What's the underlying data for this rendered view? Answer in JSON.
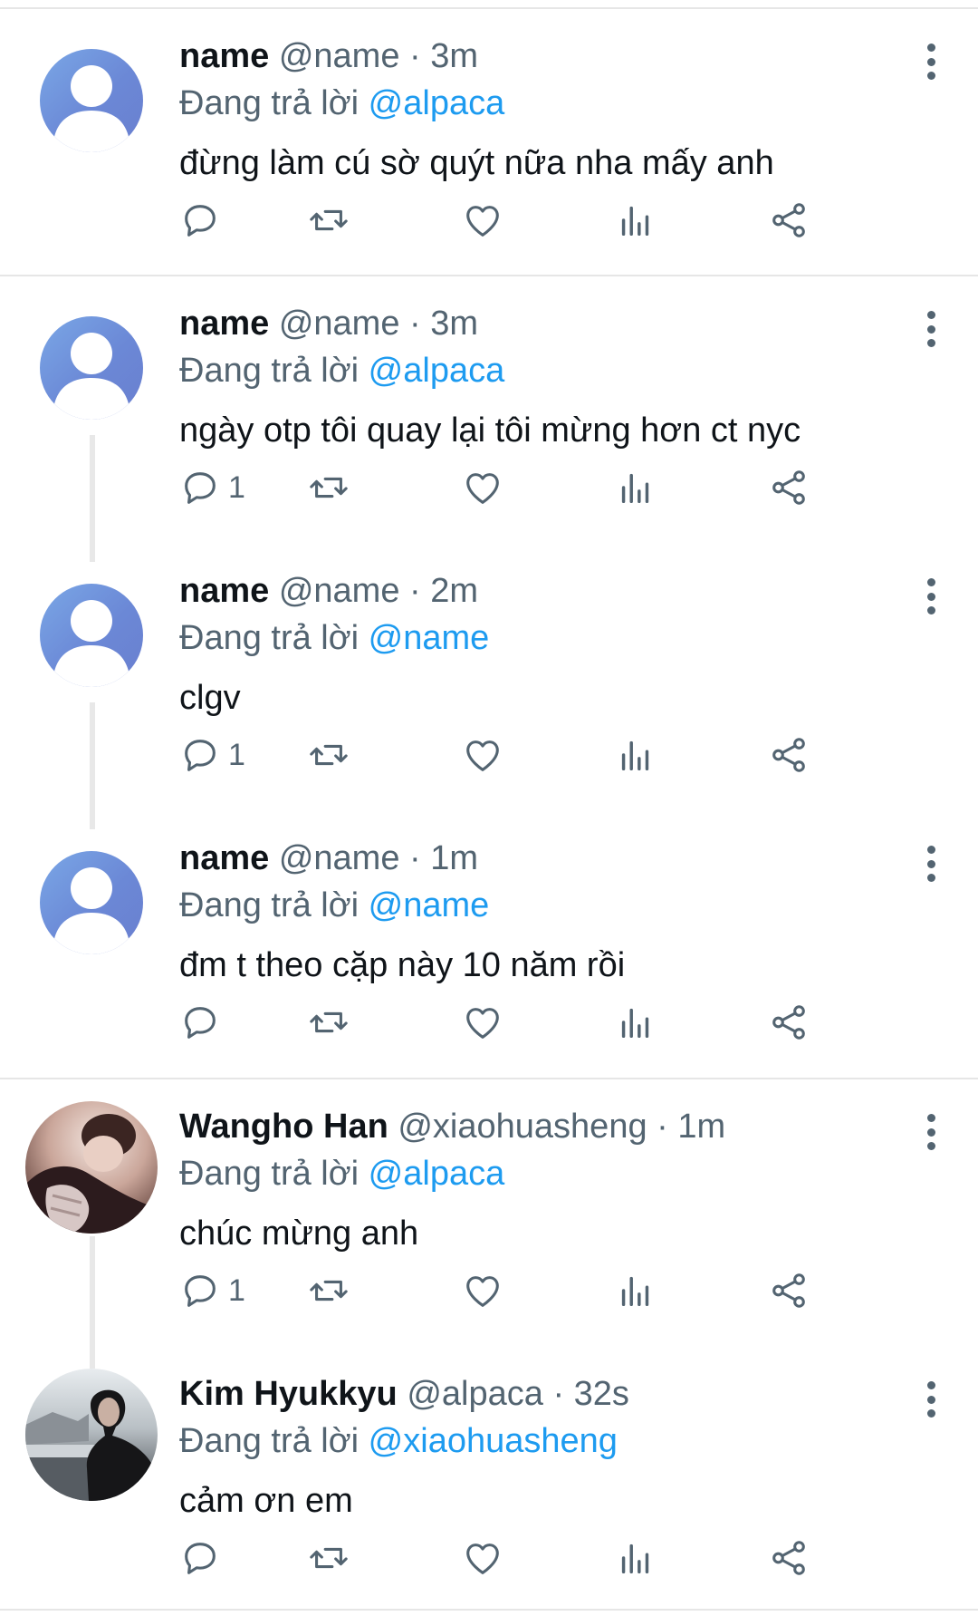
{
  "tweets": [
    {
      "name": "name",
      "handle": "@name",
      "time": "3m",
      "replying_prefix": "Đang trả lời",
      "replying_to": "@alpaca",
      "text": "đừng làm cú sờ quýt nữa nha mấy anh",
      "reply_count": ""
    },
    {
      "name": "name",
      "handle": "@name",
      "time": "3m",
      "replying_prefix": "Đang trả lời",
      "replying_to": "@alpaca",
      "text": "ngày otp tôi quay lại tôi mừng hơn ct nyc",
      "reply_count": "1"
    },
    {
      "name": "name",
      "handle": "@name",
      "time": "2m",
      "replying_prefix": "Đang trả lời",
      "replying_to": "@name",
      "text": "clgv",
      "reply_count": "1"
    },
    {
      "name": "name",
      "handle": "@name",
      "time": "1m",
      "replying_prefix": "Đang trả lời",
      "replying_to": "@name",
      "text": "đm t theo cặp này 10 năm rồi",
      "reply_count": ""
    },
    {
      "name": "Wangho Han",
      "handle": "@xiaohuasheng",
      "time": "1m",
      "replying_prefix": "Đang trả lời",
      "replying_to": "@alpaca",
      "text": "chúc mừng anh",
      "reply_count": "1"
    },
    {
      "name": "Kim Hyukkyu",
      "handle": "@alpaca",
      "time": "32s",
      "replying_prefix": "Đang trả lời",
      "replying_to": "@xiaohuasheng",
      "text": "cảm ơn em",
      "reply_count": ""
    }
  ],
  "separator": "·",
  "colors": {
    "text": "#0f1419",
    "secondary": "#536471",
    "mention": "#1d9bf0",
    "divider": "#e6e6e6"
  },
  "icons": [
    "reply-icon",
    "retweet-icon",
    "like-icon",
    "views-icon",
    "share-icon",
    "more-icon",
    "default-avatar-icon"
  ]
}
